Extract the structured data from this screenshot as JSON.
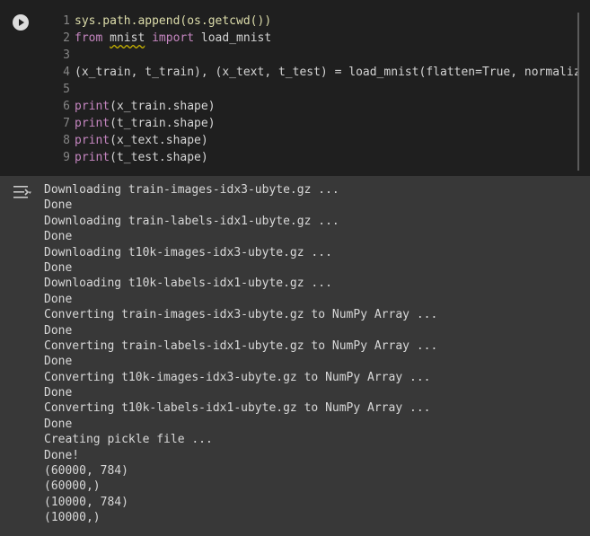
{
  "code": {
    "lines": [
      {
        "n": "1",
        "tokens": [
          {
            "t": "sys.path.append(os.getcwd())",
            "c": "fn"
          }
        ]
      },
      {
        "n": "2",
        "tokens": [
          {
            "t": "from ",
            "c": "kw"
          },
          {
            "t": "mnist",
            "c": "sq"
          },
          {
            "t": " ",
            "c": ""
          },
          {
            "t": "import",
            "c": "kw"
          },
          {
            "t": " load_mnist",
            "c": ""
          }
        ]
      },
      {
        "n": "3",
        "tokens": []
      },
      {
        "n": "4",
        "tokens": [
          {
            "t": "(x_train, t_train), (x_text, t_test) = load_mnist(flatten=True, normalize=False)",
            "c": ""
          }
        ]
      },
      {
        "n": "5",
        "tokens": []
      },
      {
        "n": "6",
        "tokens": [
          {
            "t": "print",
            "c": "kw"
          },
          {
            "t": "(x_train.shape)",
            "c": ""
          }
        ]
      },
      {
        "n": "7",
        "tokens": [
          {
            "t": "print",
            "c": "kw"
          },
          {
            "t": "(t_train.shape)",
            "c": ""
          }
        ]
      },
      {
        "n": "8",
        "tokens": [
          {
            "t": "print",
            "c": "kw"
          },
          {
            "t": "(x_text.shape)",
            "c": ""
          }
        ]
      },
      {
        "n": "9",
        "tokens": [
          {
            "t": "print",
            "c": "kw"
          },
          {
            "t": "(t_test.shape)",
            "c": ""
          }
        ]
      }
    ]
  },
  "output": {
    "lines": [
      "Downloading train-images-idx3-ubyte.gz ...",
      "Done",
      "Downloading train-labels-idx1-ubyte.gz ...",
      "Done",
      "Downloading t10k-images-idx3-ubyte.gz ...",
      "Done",
      "Downloading t10k-labels-idx1-ubyte.gz ...",
      "Done",
      "Converting train-images-idx3-ubyte.gz to NumPy Array ...",
      "Done",
      "Converting train-labels-idx1-ubyte.gz to NumPy Array ...",
      "Done",
      "Converting t10k-images-idx3-ubyte.gz to NumPy Array ...",
      "Done",
      "Converting t10k-labels-idx1-ubyte.gz to NumPy Array ...",
      "Done",
      "Creating pickle file ...",
      "Done!",
      "(60000, 784)",
      "(60000,)",
      "(10000, 784)",
      "(10000,)"
    ]
  },
  "icons": {
    "run": "play-icon",
    "output_toggle": "output-toggle-icon"
  },
  "colors": {
    "code_bg": "#1f1f1f",
    "output_bg": "#383838",
    "keyword": "#c586c0"
  }
}
